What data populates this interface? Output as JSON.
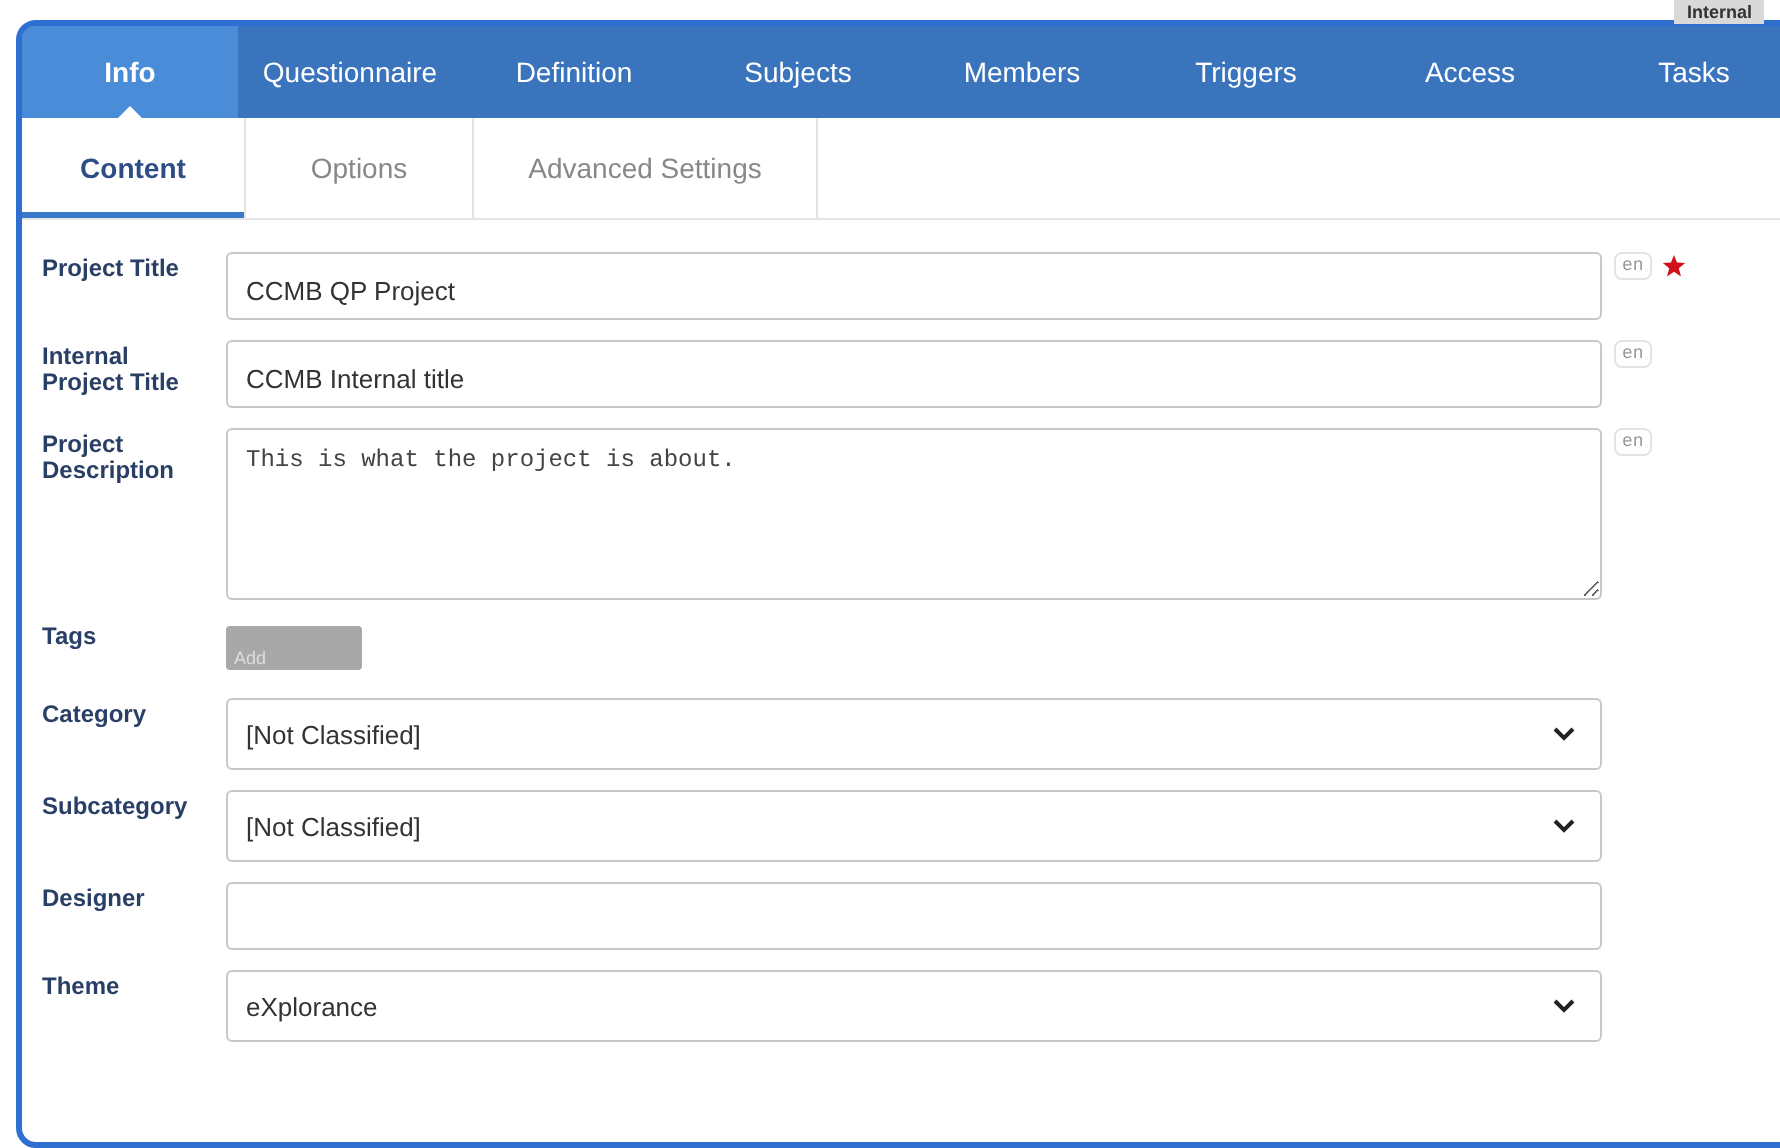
{
  "tooltip": "Internal",
  "tabs": [
    {
      "label": "Info",
      "selected": true
    },
    {
      "label": "Questionnaire",
      "selected": false
    },
    {
      "label": "Definition",
      "selected": false
    },
    {
      "label": "Subjects",
      "selected": false
    },
    {
      "label": "Members",
      "selected": false
    },
    {
      "label": "Triggers",
      "selected": false
    },
    {
      "label": "Access",
      "selected": false
    },
    {
      "label": "Tasks",
      "selected": false
    }
  ],
  "subtabs": [
    {
      "label": "Content",
      "selected": true
    },
    {
      "label": "Options",
      "selected": false
    },
    {
      "label": "Advanced Settings",
      "selected": false
    }
  ],
  "fields": [
    {
      "kind": "text",
      "label": "Project Title",
      "value": "CCMB QP Project",
      "lang": "en",
      "required": true
    },
    {
      "kind": "text",
      "label": "Internal Project Title",
      "value": "CCMB Internal title",
      "lang": "en",
      "required": false
    },
    {
      "kind": "textarea",
      "label": "Project Description",
      "value": "This is what the project is about.",
      "lang": "en",
      "required": false
    },
    {
      "kind": "tags",
      "label": "Tags",
      "button": "Add"
    },
    {
      "kind": "select",
      "label": "Category",
      "value": "[Not Classified]"
    },
    {
      "kind": "select",
      "label": "Subcategory",
      "value": "[Not Classified]"
    },
    {
      "kind": "text",
      "label": "Designer"
    },
    {
      "kind": "select",
      "label": "Theme",
      "value": "eXplorance"
    }
  ]
}
